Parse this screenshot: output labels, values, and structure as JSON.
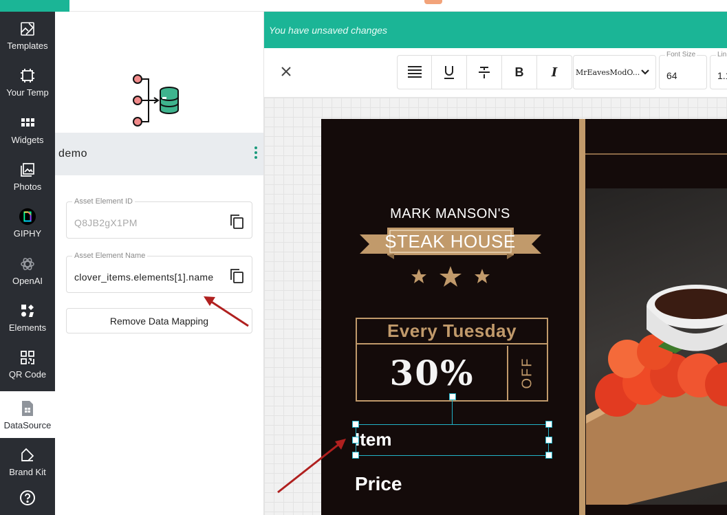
{
  "sidebar": {
    "items": [
      {
        "label": "Templates",
        "icon": "templates-icon"
      },
      {
        "label": "Your Temp",
        "icon": "your-templates-icon"
      },
      {
        "label": "Widgets",
        "icon": "widgets-icon"
      },
      {
        "label": "Photos",
        "icon": "photos-icon"
      },
      {
        "label": "GIPHY",
        "icon": "giphy-icon"
      },
      {
        "label": "OpenAI",
        "icon": "openai-icon"
      },
      {
        "label": "Elements",
        "icon": "elements-icon"
      },
      {
        "label": "QR Code",
        "icon": "qr-code-icon"
      },
      {
        "label": "DataSource",
        "icon": "datasource-icon",
        "active": true
      },
      {
        "label": "Brand Kit",
        "icon": "brand-kit-icon"
      },
      {
        "label": "",
        "icon": "help-icon"
      }
    ]
  },
  "panel": {
    "datasource_name": "demo",
    "asset_id": {
      "label": "Asset Element ID",
      "value": "Q8JB2gX1PM"
    },
    "asset_name": {
      "label": "Asset Element Name",
      "value": "clover_items.elements[1].name"
    },
    "remove_button": "Remove Data Mapping"
  },
  "banner": {
    "text": "You have unsaved changes"
  },
  "toolbar": {
    "font_name": "MrEavesModO...",
    "font_size": {
      "label": "Font Size",
      "value": "64"
    },
    "line_height": {
      "label": "Lin",
      "value": "1.1"
    }
  },
  "poster": {
    "brand_top": "MARK MANSON'S",
    "brand_ribbon": "STEAK HOUSE",
    "offer_day": "Every Tuesday",
    "offer_percent": "30%",
    "offer_off": "OFF",
    "item": "Item",
    "price": "Price"
  },
  "colors": {
    "accent": "#1bb596",
    "rail": "#2a2d33",
    "poster_bg": "#140b0a",
    "gold": "#c19a6b",
    "selection": "#22b3c9",
    "annotation_arrow": "#b0201f"
  }
}
